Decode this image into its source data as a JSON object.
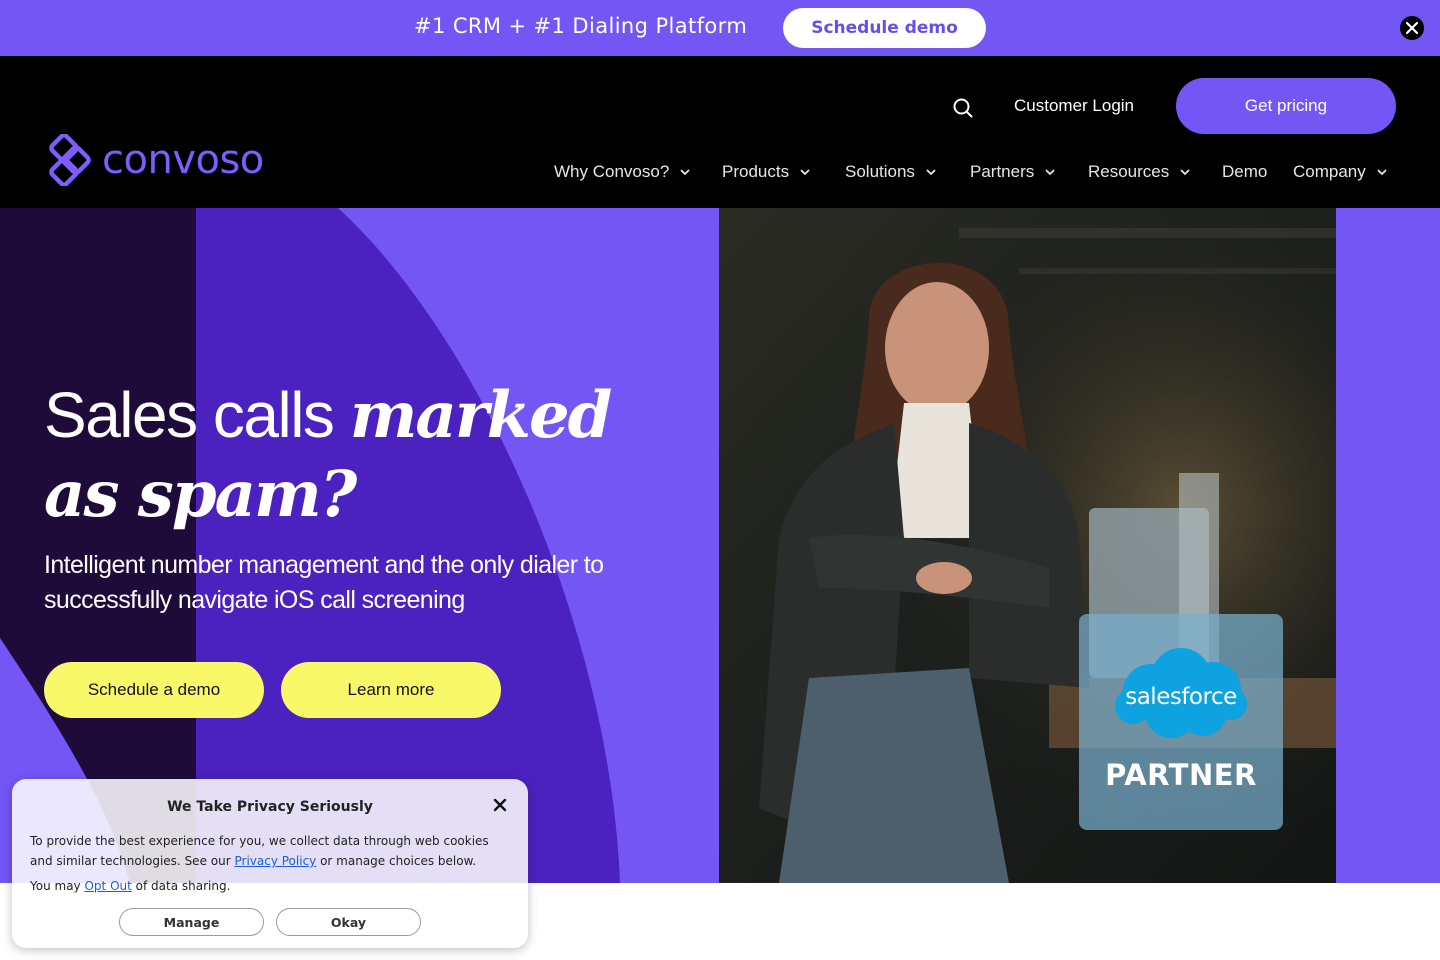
{
  "promo": {
    "text": "#1 CRM + #1 Dialing Platform",
    "button_label": "Schedule demo",
    "close_icon": "close-icon"
  },
  "header": {
    "logo_text": "convoso",
    "login_label": "Customer Login",
    "pricing_label": "Get pricing",
    "nav": [
      {
        "label": "Why Convoso?",
        "has_dropdown": true
      },
      {
        "label": "Products",
        "has_dropdown": true
      },
      {
        "label": "Solutions",
        "has_dropdown": true
      },
      {
        "label": "Partners",
        "has_dropdown": true
      },
      {
        "label": "Resources",
        "has_dropdown": true
      },
      {
        "label": "Demo",
        "has_dropdown": false
      },
      {
        "label": "Company",
        "has_dropdown": true
      }
    ]
  },
  "hero": {
    "headline_plain": "Sales calls",
    "headline_italic_1": "marked",
    "headline_italic_2": "as spam?",
    "subheading": "Intelligent number management and the only dialer to successfully navigate iOS call screening",
    "cta_primary": "Schedule a demo",
    "cta_secondary": "Learn more",
    "badge": {
      "brand": "salesforce",
      "label": "PARTNER"
    }
  },
  "privacy": {
    "title": "We Take Privacy Seriously",
    "p1_before": "To provide the best experience for you, we collect data through web cookies and similar technologies. See our",
    "p1_link": "Privacy Policy",
    "p1_after": "or manage choices below.",
    "p2_before": "You may",
    "p2_link": "Opt Out",
    "p2_after": "of data sharing.",
    "manage_label": "Manage",
    "okay_label": "Okay"
  },
  "colors": {
    "brand_purple": "#7456f5",
    "accent_yellow": "#f8f869",
    "header_bg": "#000000"
  }
}
